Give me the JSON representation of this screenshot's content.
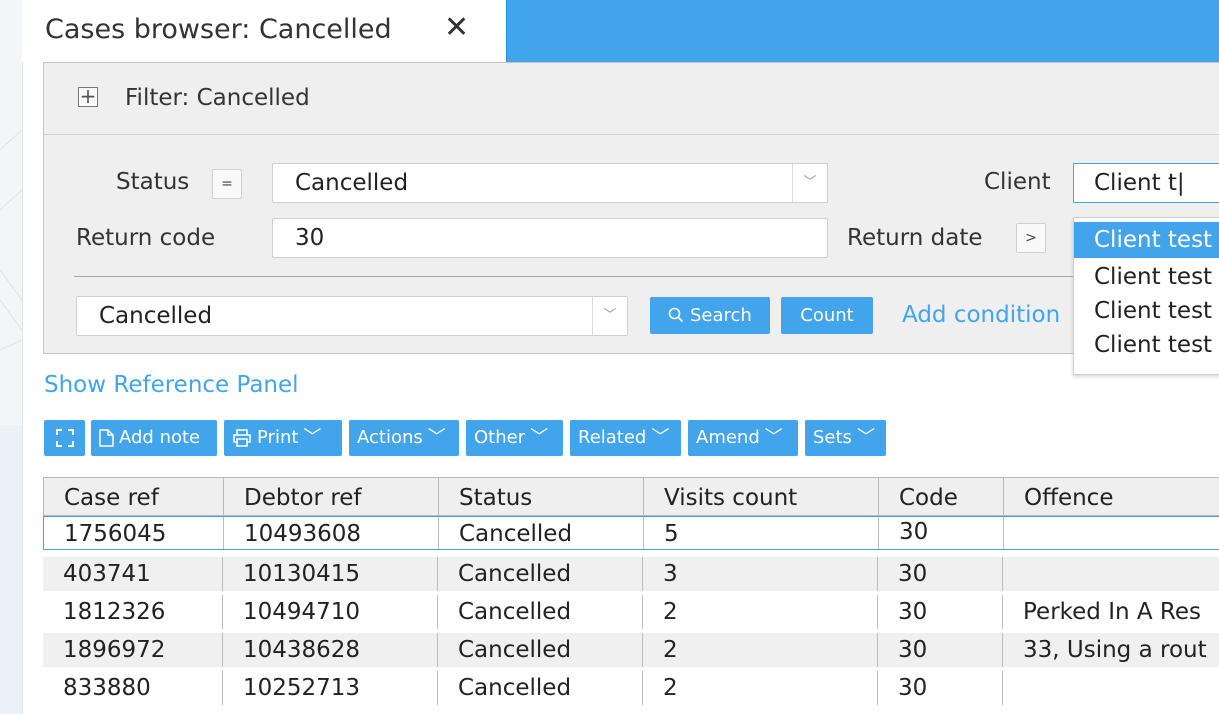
{
  "tab": {
    "title": "Cases browser: Cancelled",
    "close_glyph": "✕"
  },
  "filter": {
    "title": "Filter: Cancelled",
    "status_label": "Status",
    "status_operator": "=",
    "status_value": "Cancelled",
    "client_label": "Client",
    "client_value": "Client t|",
    "return_code_label": "Return code",
    "return_code_value": "30",
    "return_date_label": "Return date",
    "return_date_operator": ">",
    "saved_filter_value": "Cancelled",
    "search_label": "Search",
    "count_label": "Count",
    "add_condition_label": "Add condition"
  },
  "client_dropdown": [
    "Client test",
    "Client test",
    "Client test",
    "Client test"
  ],
  "show_reference_panel": "Show Reference Panel",
  "toolbar": {
    "add_note": "Add note",
    "print": "Print",
    "actions": "Actions",
    "other": "Other",
    "related": "Related",
    "amend": "Amend",
    "sets": "Sets"
  },
  "table": {
    "headers": [
      "Case ref",
      "Debtor ref",
      "Status",
      "Visits count",
      "Code",
      "Offence"
    ],
    "rows": [
      [
        "1756045",
        "10493608",
        "Cancelled",
        "5",
        "30",
        ""
      ],
      [
        "403741",
        "10130415",
        "Cancelled",
        "3",
        "30",
        ""
      ],
      [
        "1812326",
        "10494710",
        "Cancelled",
        "2",
        "30",
        "Perked In A Res"
      ],
      [
        "1896972",
        "10438628",
        "Cancelled",
        "2",
        "30",
        "33, Using a rout"
      ],
      [
        "833880",
        "10252713",
        "Cancelled",
        "2",
        "30",
        ""
      ]
    ]
  },
  "colors": {
    "accent": "#42a5ec",
    "panel": "#efefef"
  },
  "icons": [
    "close-icon",
    "plus-icon",
    "chevron-down-icon",
    "search-icon",
    "expand-icon",
    "document-icon",
    "printer-icon"
  ]
}
